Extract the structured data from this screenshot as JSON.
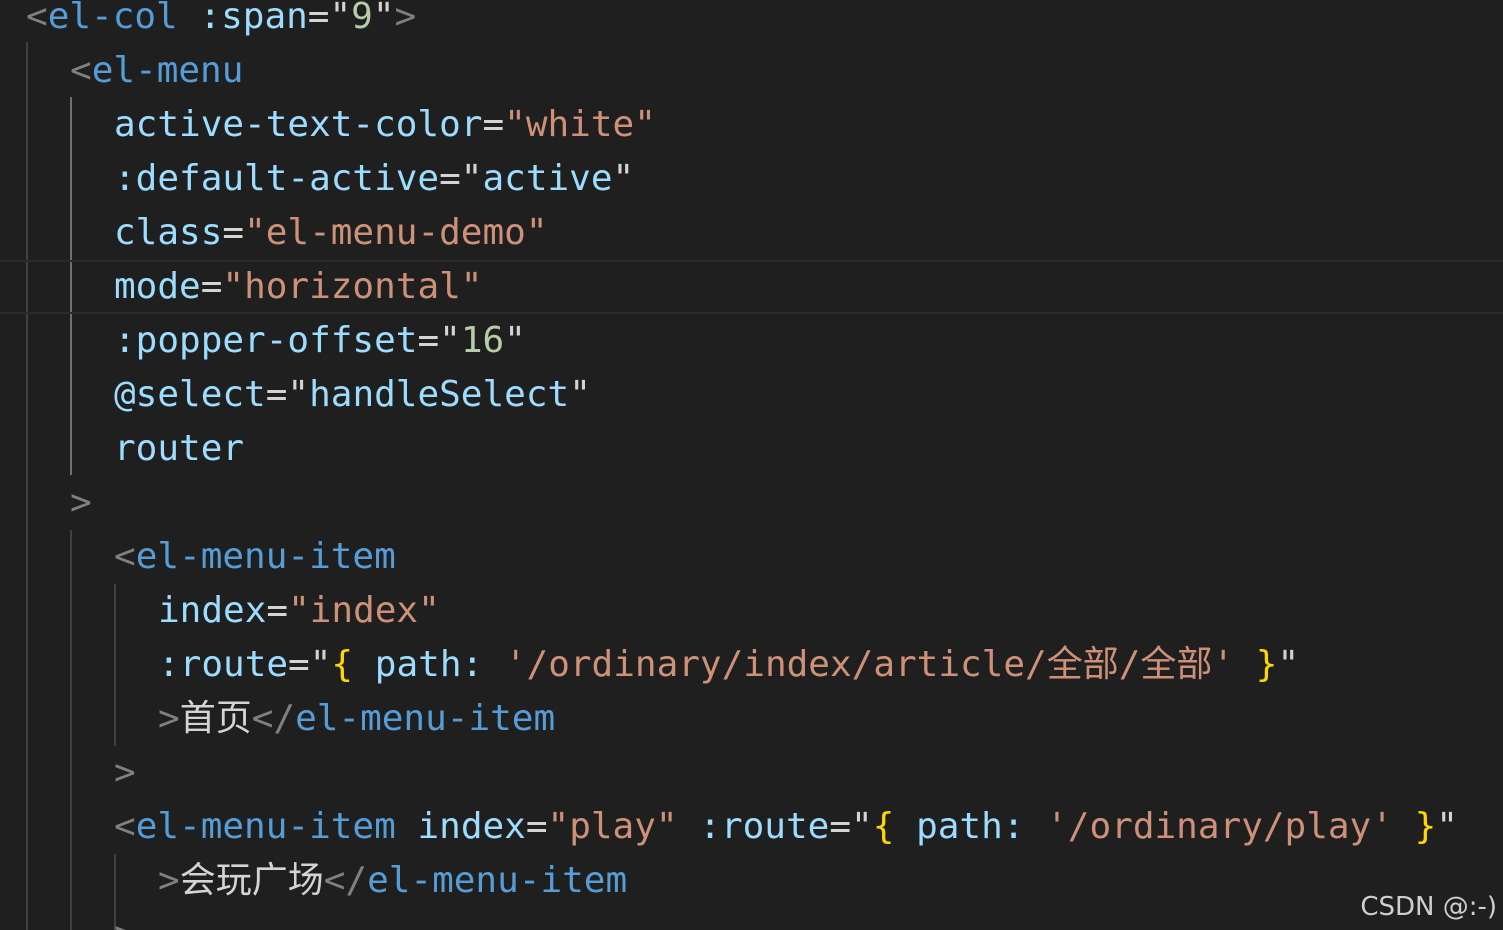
{
  "code_lines": [
    {
      "tokens": [
        {
          "t": "<",
          "c": "bracket"
        },
        {
          "t": "el-col",
          "c": "tag"
        },
        {
          "t": " ",
          "c": "text"
        },
        {
          "t": ":span",
          "c": "attr"
        },
        {
          "t": "=",
          "c": "eq"
        },
        {
          "t": "\"",
          "c": "text"
        },
        {
          "t": "9",
          "c": "num"
        },
        {
          "t": "\"",
          "c": "text"
        },
        {
          "t": ">",
          "c": "bracket"
        }
      ]
    },
    {
      "tokens": [
        {
          "t": "<",
          "c": "bracket"
        },
        {
          "t": "el-menu",
          "c": "tag"
        }
      ]
    },
    {
      "tokens": [
        {
          "t": "active-text-color",
          "c": "attr"
        },
        {
          "t": "=",
          "c": "eq"
        },
        {
          "t": "\"white\"",
          "c": "str"
        }
      ]
    },
    {
      "tokens": [
        {
          "t": ":default-active",
          "c": "attr"
        },
        {
          "t": "=",
          "c": "eq"
        },
        {
          "t": "\"",
          "c": "text"
        },
        {
          "t": "active",
          "c": "attr"
        },
        {
          "t": "\"",
          "c": "text"
        }
      ]
    },
    {
      "tokens": [
        {
          "t": "class",
          "c": "attr"
        },
        {
          "t": "=",
          "c": "eq"
        },
        {
          "t": "\"el-menu-demo\"",
          "c": "str"
        }
      ]
    },
    {
      "tokens": [
        {
          "t": "mode",
          "c": "attr"
        },
        {
          "t": "=",
          "c": "eq"
        },
        {
          "t": "\"horizontal\"",
          "c": "str"
        }
      ]
    },
    {
      "tokens": [
        {
          "t": ":popper-offset",
          "c": "attr"
        },
        {
          "t": "=",
          "c": "eq"
        },
        {
          "t": "\"",
          "c": "text"
        },
        {
          "t": "16",
          "c": "num"
        },
        {
          "t": "\"",
          "c": "text"
        }
      ]
    },
    {
      "tokens": [
        {
          "t": "@select",
          "c": "attr"
        },
        {
          "t": "=",
          "c": "eq"
        },
        {
          "t": "\"",
          "c": "text"
        },
        {
          "t": "handleSelect",
          "c": "attr"
        },
        {
          "t": "\"",
          "c": "text"
        }
      ]
    },
    {
      "tokens": [
        {
          "t": "router",
          "c": "attr"
        }
      ]
    },
    {
      "tokens": [
        {
          "t": ">",
          "c": "bracket"
        }
      ]
    },
    {
      "tokens": [
        {
          "t": "<",
          "c": "bracket"
        },
        {
          "t": "el-menu-item",
          "c": "tag"
        }
      ]
    },
    {
      "tokens": [
        {
          "t": "index",
          "c": "attr"
        },
        {
          "t": "=",
          "c": "eq"
        },
        {
          "t": "\"index\"",
          "c": "str"
        }
      ]
    },
    {
      "tokens": [
        {
          "t": ":route",
          "c": "attr"
        },
        {
          "t": "=",
          "c": "eq"
        },
        {
          "t": "\"",
          "c": "text"
        },
        {
          "t": "{",
          "c": "brace"
        },
        {
          "t": " ",
          "c": "text"
        },
        {
          "t": "path:",
          "c": "prop"
        },
        {
          "t": " ",
          "c": "text"
        },
        {
          "t": "'/ordinary/index/article/全部/全部'",
          "c": "str"
        },
        {
          "t": " ",
          "c": "text"
        },
        {
          "t": "}",
          "c": "brace"
        },
        {
          "t": "\"",
          "c": "text"
        }
      ]
    },
    {
      "tokens": [
        {
          "t": ">",
          "c": "bracket"
        },
        {
          "t": "首页",
          "c": "text"
        },
        {
          "t": "</",
          "c": "bracket"
        },
        {
          "t": "el-menu-item",
          "c": "tag"
        }
      ]
    },
    {
      "tokens": [
        {
          "t": ">",
          "c": "bracket"
        }
      ]
    },
    {
      "tokens": [
        {
          "t": "<",
          "c": "bracket"
        },
        {
          "t": "el-menu-item",
          "c": "tag"
        },
        {
          "t": " ",
          "c": "text"
        },
        {
          "t": "index",
          "c": "attr"
        },
        {
          "t": "=",
          "c": "eq"
        },
        {
          "t": "\"play\"",
          "c": "str"
        },
        {
          "t": " ",
          "c": "text"
        },
        {
          "t": ":route",
          "c": "attr"
        },
        {
          "t": "=",
          "c": "eq"
        },
        {
          "t": "\"",
          "c": "text"
        },
        {
          "t": "{",
          "c": "brace"
        },
        {
          "t": " ",
          "c": "text"
        },
        {
          "t": "path:",
          "c": "prop"
        },
        {
          "t": " ",
          "c": "text"
        },
        {
          "t": "'/ordinary/play'",
          "c": "str"
        },
        {
          "t": " ",
          "c": "text"
        },
        {
          "t": "}",
          "c": "brace"
        },
        {
          "t": "\"",
          "c": "text"
        }
      ]
    },
    {
      "tokens": [
        {
          "t": ">",
          "c": "bracket"
        },
        {
          "t": "会玩广场",
          "c": "text"
        },
        {
          "t": "</",
          "c": "bracket"
        },
        {
          "t": "el-menu-item",
          "c": "tag"
        }
      ]
    },
    {
      "tokens": [
        {
          "t": ">",
          "c": "bracket"
        }
      ]
    }
  ],
  "watermark": "CSDN @:-)",
  "colors": {
    "background": "#1f1f1f",
    "tag": "#569cd6",
    "attribute": "#9cdcfe",
    "string": "#ce9178",
    "number": "#b5cea8",
    "brace": "#ffd700",
    "bracket": "#808080",
    "text": "#d4d4d4"
  }
}
